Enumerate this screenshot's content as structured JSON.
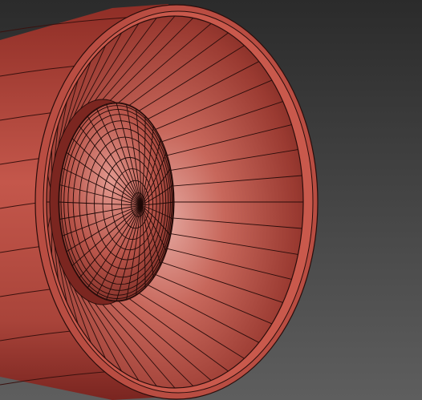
{
  "viewport": {
    "background_top": "#2b2b2b",
    "background_bottom": "#5e5e5e"
  },
  "model": {
    "subject": "nozzle-wireframe-render",
    "body_color": "#b84a3f",
    "body_highlight": "#d9776b",
    "body_shadow": "#6e211b",
    "inner_color": "#a9443a",
    "inner_highlight": "#e2a19a",
    "wire_color": "#2a0d0b",
    "cone_segments": 44,
    "sphere_meridians": 36,
    "sphere_parallels": 12
  }
}
